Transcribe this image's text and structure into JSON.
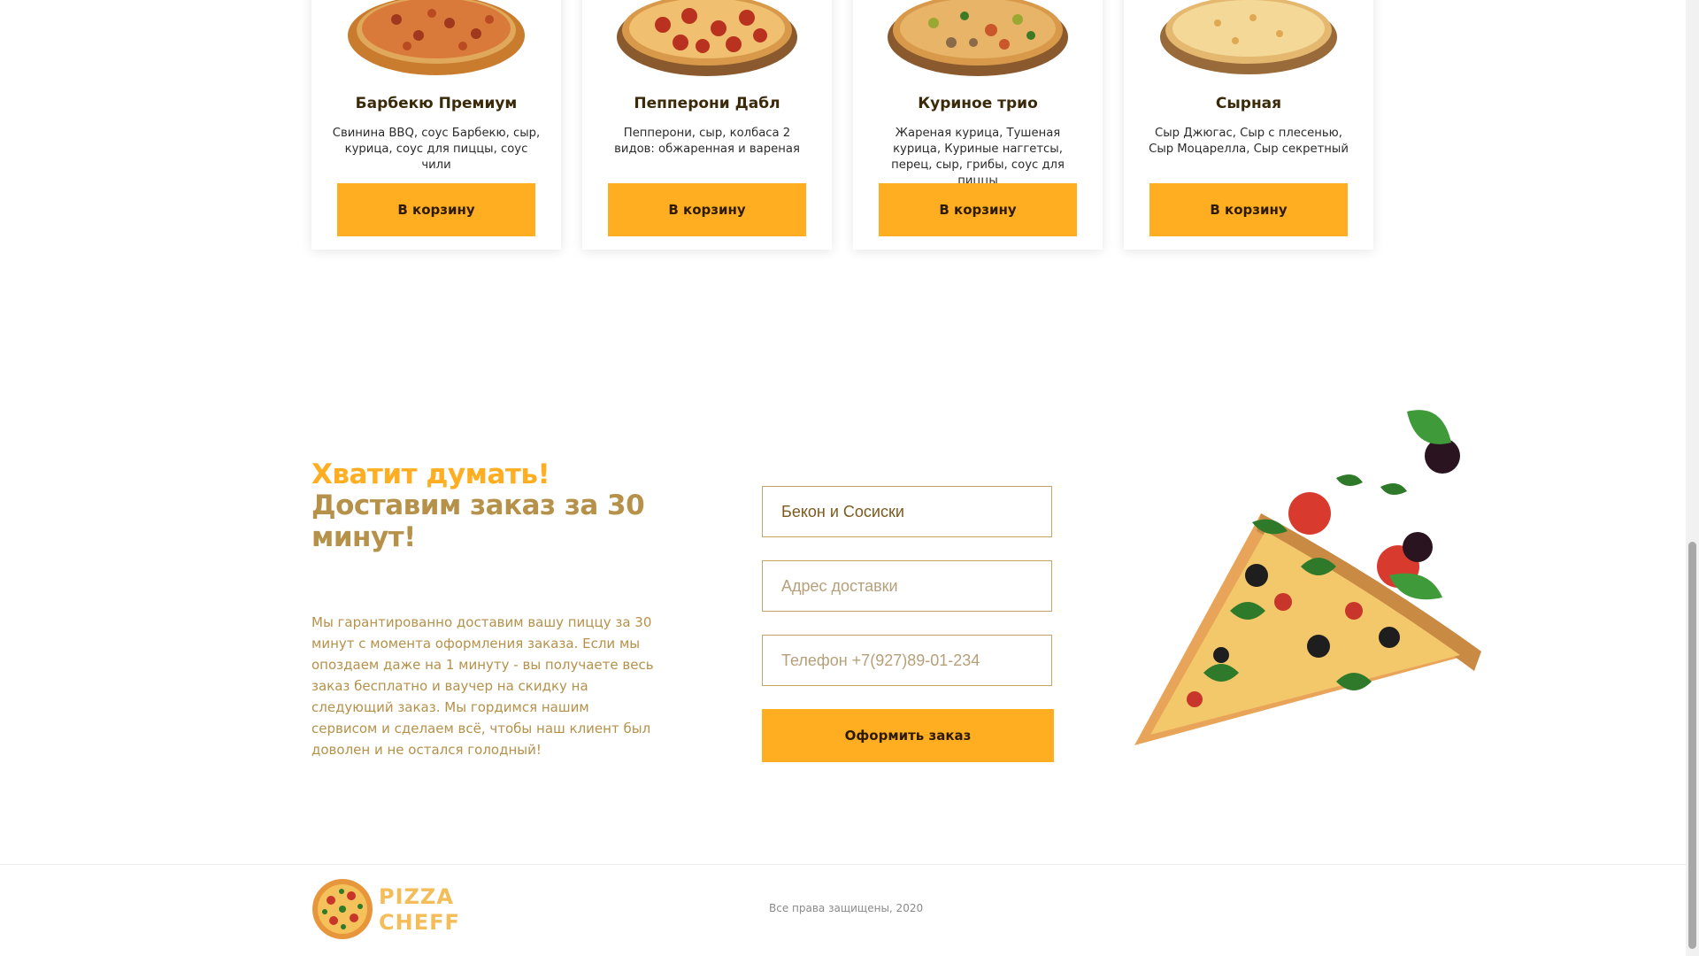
{
  "products": [
    {
      "title": "Барбекю Премиум",
      "description": "Свинина BBQ, соус Барбекю, сыр, курица, соус для пиццы, соус чили",
      "button_label": "В корзину"
    },
    {
      "title": "Пепперони Дабл",
      "description": "Пепперони, сыр, колбаса 2 видов: обжаренная и вареная",
      "button_label": "В корзину"
    },
    {
      "title": "Куриное трио",
      "description": "Жареная курица, Тушеная курица, Куриные наггетсы, перец, сыр, грибы, соус для пиццы",
      "button_label": "В корзину"
    },
    {
      "title": "Сырная",
      "description": "Сыр Джюгас, Сыр с плесенью, Сыр Моцарелла, Сыр секретный",
      "button_label": "В корзину"
    }
  ],
  "promo": {
    "accent_line": "Хватит думать!",
    "heading": "Доставим заказ за 30 минут!",
    "text": "Мы гарантированно доставим вашу пиццу за 30 минут с момента оформления заказа. Если мы опоздаем даже на 1 минуту - вы получаете весь заказ бесплатно и ваучер на скидку на следующий заказ. Мы гордимся нашим сервисом и сделаем всё, чтобы наш клиент был доволен и не остался голодный!"
  },
  "order_form": {
    "pizza_value": "Бекон и Сосиски",
    "address_placeholder": "Адрес доставки",
    "phone_placeholder": "Телефон +7(927)89-01-234",
    "submit_label": "Оформить заказ"
  },
  "footer": {
    "logo_line1": "PIZZA",
    "logo_line2": "CHEFF",
    "copyright": "Все права защищены, 2020"
  },
  "colors": {
    "accent": "#ffad21",
    "brown_text": "#b5914a",
    "logo_text": "#f5bd5a"
  }
}
